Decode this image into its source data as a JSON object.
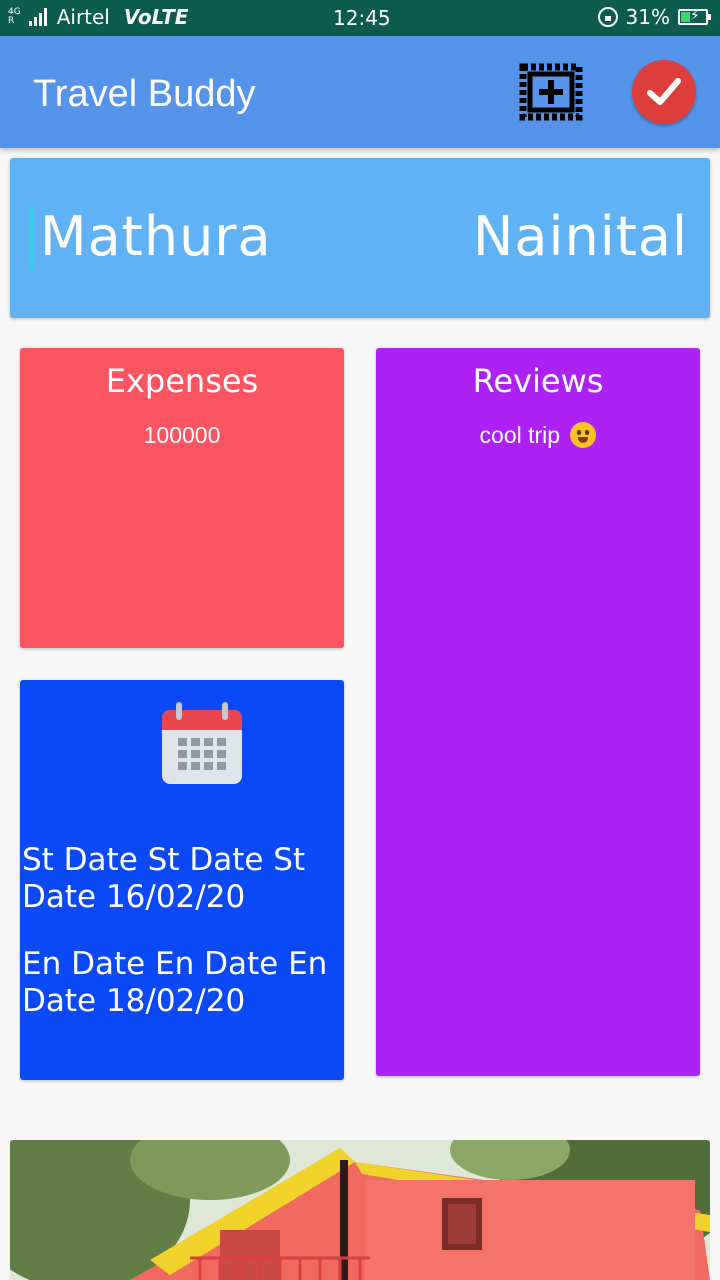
{
  "status_bar": {
    "network_type": "4G",
    "roaming": "R",
    "carrier": "Airtel",
    "volte": "VoLTE",
    "time": "12:45",
    "battery": "31%"
  },
  "app_bar": {
    "title": "Travel Buddy",
    "add_photo_icon": "add-photo-icon",
    "done_icon": "check-icon"
  },
  "route": {
    "from": "Mathura",
    "to": "Nainital"
  },
  "expenses": {
    "title": "Expenses",
    "amount": "100000"
  },
  "reviews": {
    "title": "Reviews",
    "text": "cool trip"
  },
  "dates": {
    "calendar_icon": "calendar-icon",
    "start": "St Date St Date St Date 16/02/20",
    "end": "En Date En Date En Date 18/02/20"
  },
  "colors": {
    "status_bar": "#0b5b4f",
    "app_bar": "#5594ea",
    "route_card": "#61b2f4",
    "expenses_card": "#fd5461",
    "reviews_card": "#ad21f5",
    "dates_card": "#0b49f6",
    "done_button": "#de3e3b"
  }
}
